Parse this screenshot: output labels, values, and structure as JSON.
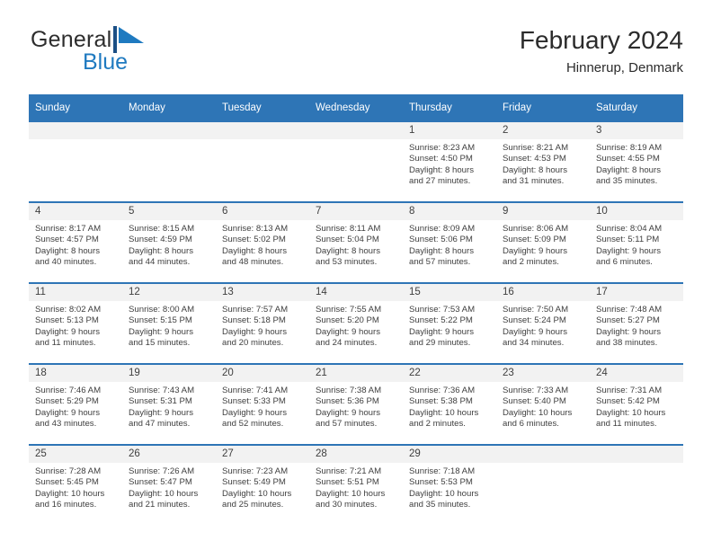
{
  "brand": {
    "name_part1": "General",
    "name_part2": "Blue",
    "mark_icon": "blue-triangle-flag-icon",
    "color_primary": "#1f7ac0",
    "color_dark": "#2d2d2d"
  },
  "header": {
    "title": "February 2024",
    "subtitle": "Hinnerup, Denmark"
  },
  "theme": {
    "header_bg": "#2e75b6",
    "header_text": "#ffffff",
    "daynum_bg": "#f2f2f2",
    "row_border": "#2e75b6",
    "body_text": "#3f3f3f"
  },
  "weekday_headers": [
    "Sunday",
    "Monday",
    "Tuesday",
    "Wednesday",
    "Thursday",
    "Friday",
    "Saturday"
  ],
  "weeks": [
    [
      {
        "day": "",
        "lines": []
      },
      {
        "day": "",
        "lines": []
      },
      {
        "day": "",
        "lines": []
      },
      {
        "day": "",
        "lines": []
      },
      {
        "day": "1",
        "lines": [
          "Sunrise: 8:23 AM",
          "Sunset: 4:50 PM",
          "Daylight: 8 hours",
          "and 27 minutes."
        ]
      },
      {
        "day": "2",
        "lines": [
          "Sunrise: 8:21 AM",
          "Sunset: 4:53 PM",
          "Daylight: 8 hours",
          "and 31 minutes."
        ]
      },
      {
        "day": "3",
        "lines": [
          "Sunrise: 8:19 AM",
          "Sunset: 4:55 PM",
          "Daylight: 8 hours",
          "and 35 minutes."
        ]
      }
    ],
    [
      {
        "day": "4",
        "lines": [
          "Sunrise: 8:17 AM",
          "Sunset: 4:57 PM",
          "Daylight: 8 hours",
          "and 40 minutes."
        ]
      },
      {
        "day": "5",
        "lines": [
          "Sunrise: 8:15 AM",
          "Sunset: 4:59 PM",
          "Daylight: 8 hours",
          "and 44 minutes."
        ]
      },
      {
        "day": "6",
        "lines": [
          "Sunrise: 8:13 AM",
          "Sunset: 5:02 PM",
          "Daylight: 8 hours",
          "and 48 minutes."
        ]
      },
      {
        "day": "7",
        "lines": [
          "Sunrise: 8:11 AM",
          "Sunset: 5:04 PM",
          "Daylight: 8 hours",
          "and 53 minutes."
        ]
      },
      {
        "day": "8",
        "lines": [
          "Sunrise: 8:09 AM",
          "Sunset: 5:06 PM",
          "Daylight: 8 hours",
          "and 57 minutes."
        ]
      },
      {
        "day": "9",
        "lines": [
          "Sunrise: 8:06 AM",
          "Sunset: 5:09 PM",
          "Daylight: 9 hours",
          "and 2 minutes."
        ]
      },
      {
        "day": "10",
        "lines": [
          "Sunrise: 8:04 AM",
          "Sunset: 5:11 PM",
          "Daylight: 9 hours",
          "and 6 minutes."
        ]
      }
    ],
    [
      {
        "day": "11",
        "lines": [
          "Sunrise: 8:02 AM",
          "Sunset: 5:13 PM",
          "Daylight: 9 hours",
          "and 11 minutes."
        ]
      },
      {
        "day": "12",
        "lines": [
          "Sunrise: 8:00 AM",
          "Sunset: 5:15 PM",
          "Daylight: 9 hours",
          "and 15 minutes."
        ]
      },
      {
        "day": "13",
        "lines": [
          "Sunrise: 7:57 AM",
          "Sunset: 5:18 PM",
          "Daylight: 9 hours",
          "and 20 minutes."
        ]
      },
      {
        "day": "14",
        "lines": [
          "Sunrise: 7:55 AM",
          "Sunset: 5:20 PM",
          "Daylight: 9 hours",
          "and 24 minutes."
        ]
      },
      {
        "day": "15",
        "lines": [
          "Sunrise: 7:53 AM",
          "Sunset: 5:22 PM",
          "Daylight: 9 hours",
          "and 29 minutes."
        ]
      },
      {
        "day": "16",
        "lines": [
          "Sunrise: 7:50 AM",
          "Sunset: 5:24 PM",
          "Daylight: 9 hours",
          "and 34 minutes."
        ]
      },
      {
        "day": "17",
        "lines": [
          "Sunrise: 7:48 AM",
          "Sunset: 5:27 PM",
          "Daylight: 9 hours",
          "and 38 minutes."
        ]
      }
    ],
    [
      {
        "day": "18",
        "lines": [
          "Sunrise: 7:46 AM",
          "Sunset: 5:29 PM",
          "Daylight: 9 hours",
          "and 43 minutes."
        ]
      },
      {
        "day": "19",
        "lines": [
          "Sunrise: 7:43 AM",
          "Sunset: 5:31 PM",
          "Daylight: 9 hours",
          "and 47 minutes."
        ]
      },
      {
        "day": "20",
        "lines": [
          "Sunrise: 7:41 AM",
          "Sunset: 5:33 PM",
          "Daylight: 9 hours",
          "and 52 minutes."
        ]
      },
      {
        "day": "21",
        "lines": [
          "Sunrise: 7:38 AM",
          "Sunset: 5:36 PM",
          "Daylight: 9 hours",
          "and 57 minutes."
        ]
      },
      {
        "day": "22",
        "lines": [
          "Sunrise: 7:36 AM",
          "Sunset: 5:38 PM",
          "Daylight: 10 hours",
          "and 2 minutes."
        ]
      },
      {
        "day": "23",
        "lines": [
          "Sunrise: 7:33 AM",
          "Sunset: 5:40 PM",
          "Daylight: 10 hours",
          "and 6 minutes."
        ]
      },
      {
        "day": "24",
        "lines": [
          "Sunrise: 7:31 AM",
          "Sunset: 5:42 PM",
          "Daylight: 10 hours",
          "and 11 minutes."
        ]
      }
    ],
    [
      {
        "day": "25",
        "lines": [
          "Sunrise: 7:28 AM",
          "Sunset: 5:45 PM",
          "Daylight: 10 hours",
          "and 16 minutes."
        ]
      },
      {
        "day": "26",
        "lines": [
          "Sunrise: 7:26 AM",
          "Sunset: 5:47 PM",
          "Daylight: 10 hours",
          "and 21 minutes."
        ]
      },
      {
        "day": "27",
        "lines": [
          "Sunrise: 7:23 AM",
          "Sunset: 5:49 PM",
          "Daylight: 10 hours",
          "and 25 minutes."
        ]
      },
      {
        "day": "28",
        "lines": [
          "Sunrise: 7:21 AM",
          "Sunset: 5:51 PM",
          "Daylight: 10 hours",
          "and 30 minutes."
        ]
      },
      {
        "day": "29",
        "lines": [
          "Sunrise: 7:18 AM",
          "Sunset: 5:53 PM",
          "Daylight: 10 hours",
          "and 35 minutes."
        ]
      },
      {
        "day": "",
        "lines": []
      },
      {
        "day": "",
        "lines": []
      }
    ]
  ]
}
